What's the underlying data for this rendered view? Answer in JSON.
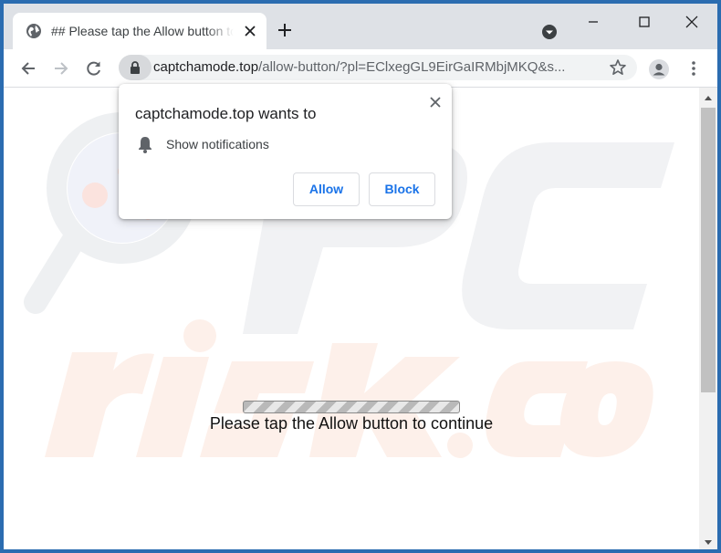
{
  "tab": {
    "title": "## Please tap the Allow button to continue"
  },
  "omnibox": {
    "url_host": "captchamode.top",
    "url_path": "/allow-button/?pl=EClxegGL9EirGaIRMbjMKQ&s..."
  },
  "popup": {
    "title": "captchamode.top wants to",
    "permission": "Show notifications",
    "allow_label": "Allow",
    "block_label": "Block"
  },
  "page": {
    "message": "Please tap the Allow button to continue"
  },
  "colors": {
    "accent": "#1a73e8",
    "tabstrip": "#dee1e6",
    "window_border": "#2b6cb0"
  },
  "icons": {
    "tab": [
      "globe-icon",
      "close-icon",
      "new-tab-icon",
      "tab-search-icon"
    ],
    "window": [
      "minimize-icon",
      "maximize-icon",
      "close-window-icon"
    ],
    "toolbar": [
      "back-icon",
      "forward-icon",
      "reload-icon",
      "lock-icon",
      "star-icon",
      "profile-icon",
      "menu-icon"
    ],
    "popup": [
      "close-icon",
      "bell-icon"
    ]
  }
}
